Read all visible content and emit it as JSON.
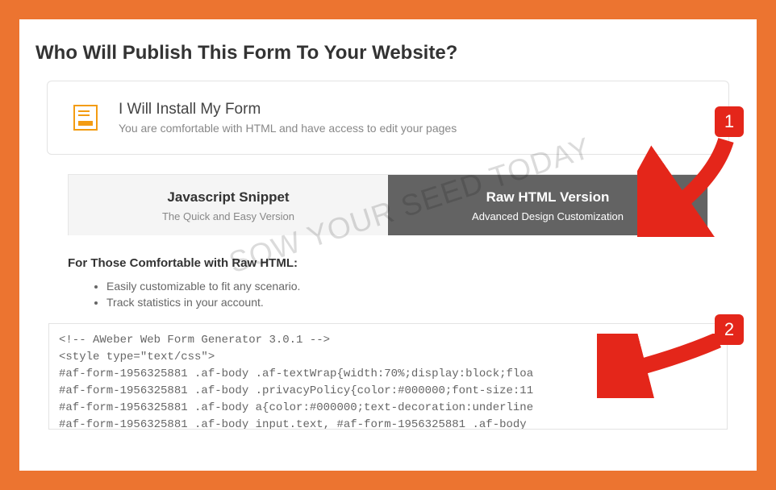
{
  "page": {
    "title": "Who Will Publish This Form To Your Website?"
  },
  "install": {
    "title": "I Will Install My Form",
    "subtitle": "You are comfortable with HTML and have access to edit your pages"
  },
  "tabs": {
    "js": {
      "title": "Javascript Snippet",
      "subtitle": "The Quick and Easy Version"
    },
    "raw": {
      "title": "Raw HTML Version",
      "subtitle": "Advanced Design Customization"
    }
  },
  "section": {
    "heading": "For Those Comfortable with Raw HTML:",
    "bullets": [
      "Easily customizable to fit any scenario.",
      "Track statistics in your account."
    ]
  },
  "code": "<!-- AWeber Web Form Generator 3.0.1 -->\n<style type=\"text/css\">\n#af-form-1956325881 .af-body .af-textWrap{width:70%;display:block;floa\n#af-form-1956325881 .af-body .privacyPolicy{color:#000000;font-size:11\n#af-form-1956325881 .af-body a{color:#000000;text-decoration:underline\n#af-form-1956325881 .af-body input.text, #af-form-1956325881 .af-body ",
  "watermark": "SOW YOUR SEED TODAY",
  "callouts": {
    "one": "1",
    "two": "2"
  }
}
